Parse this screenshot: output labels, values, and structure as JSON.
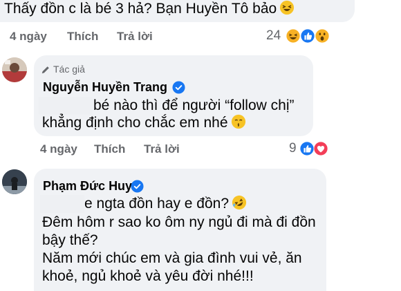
{
  "comment1": {
    "text": "Thấy đồn c là bé 3 hả? Bạn Huyền Tô bảo",
    "time": "4 ngày",
    "like_label": "Thích",
    "reply_label": "Trả lời",
    "reaction_count": "24",
    "emoji": "laughing-emoji",
    "reactions": [
      "haha-reaction",
      "like-reaction",
      "wow-reaction"
    ]
  },
  "comment2": {
    "badge": "Tác giả",
    "name": "Nguyễn Huyền Trang",
    "line1": "bé nào thì để người “follow chị”",
    "line2": "khẳng định cho chắc em nhé",
    "emoji": "kissing-emoji",
    "time": "4 ngày",
    "like_label": "Thích",
    "reply_label": "Trả lời",
    "reaction_count": "9",
    "reactions": [
      "like-reaction",
      "love-reaction"
    ]
  },
  "comment3": {
    "name": "Phạm Đức Huy",
    "line1": "e ngta đồn hay e đồn?",
    "line2": "Đêm hôm r sao ko ôm ny ngủ đi mà đi đồn",
    "line3": "bậy thế?",
    "line4": "Năm mới chúc em và gia đình vui vẻ, ăn",
    "line5": "khoẻ, ngủ khoẻ và yêu đời nhé!!!",
    "emoji": "rofl-emoji"
  },
  "colors": {
    "bubble": "#f0f2f5",
    "meta": "#65676b",
    "verified": "#1877f2",
    "love": "#f33e58",
    "haha": "#f7b125"
  }
}
